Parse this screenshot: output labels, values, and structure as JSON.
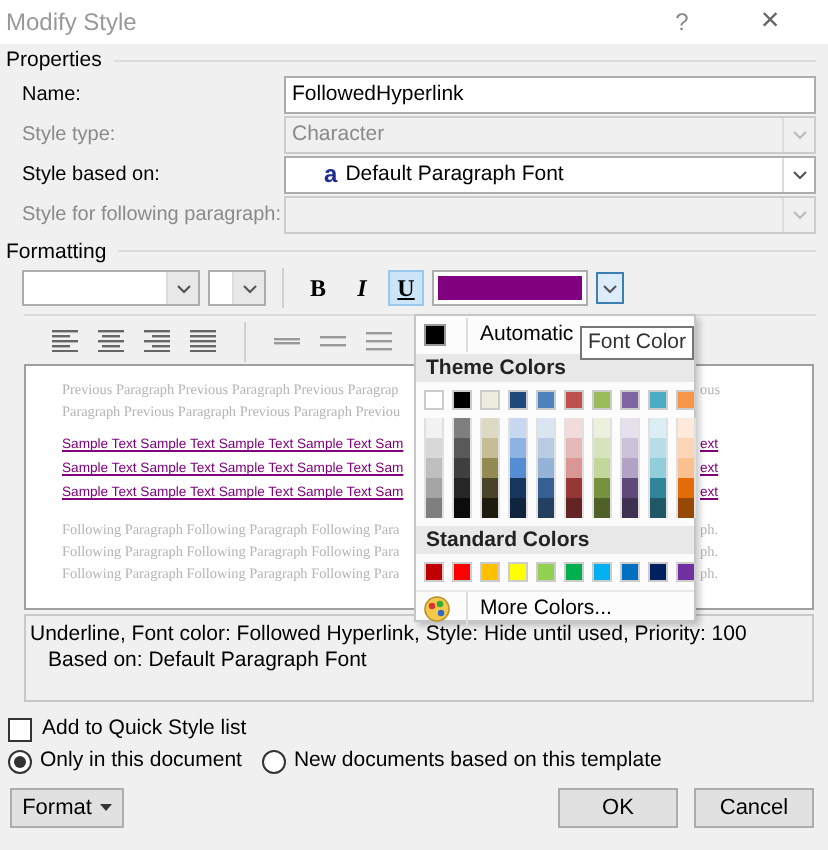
{
  "window": {
    "title": "Modify Style",
    "help": "?",
    "close": "×"
  },
  "properties": {
    "heading": "Properties",
    "fields": [
      {
        "label": "Name:",
        "kind": "text",
        "value": "FollowedHyperlink",
        "disabled": false
      },
      {
        "label": "Style type:",
        "kind": "select",
        "value": "Character",
        "disabled": true
      },
      {
        "label": "Style based on:",
        "kind": "select",
        "icon": "a",
        "value": "Default Paragraph Font",
        "disabled": false
      },
      {
        "label": "Style for following paragraph:",
        "kind": "select",
        "disabled": true
      }
    ]
  },
  "formatting": {
    "heading": "Formatting",
    "styles": [
      {
        "label": "B",
        "selected": false
      },
      {
        "label": "I",
        "selected": false
      },
      {
        "label": "U",
        "selected": true
      }
    ],
    "font_color": {
      "color": "#800080",
      "expanded": true
    }
  },
  "alignment": [
    {
      "kind": "left"
    },
    {
      "kind": "center"
    },
    {
      "kind": "right"
    },
    {
      "kind": "justify"
    },
    {
      "kind": "single"
    },
    {
      "kind": "onehalf"
    },
    {
      "kind": "double"
    }
  ],
  "preview": [
    {
      "kind": "previous",
      "left": "Previous Paragraph Previous Paragraph Previous Paragrap",
      "right": "ous"
    },
    {
      "kind": "previous",
      "left": "Paragraph Previous Paragraph Previous Paragraph Previou"
    },
    {
      "kind": "sample",
      "left": "Sample Text Sample Text Sample Text Sample Text Sam",
      "right": "ext"
    },
    {
      "kind": "sample",
      "left": "Sample Text Sample Text Sample Text Sample Text Sam",
      "right": "ext"
    },
    {
      "kind": "sample",
      "left": "Sample Text Sample Text Sample Text Sample Text Sam",
      "right": "ext"
    },
    {
      "kind": "following",
      "left": "Following Paragraph Following Paragraph Following Para",
      "right": "ph."
    },
    {
      "kind": "following",
      "left": "Following Paragraph Following Paragraph Following Para",
      "right": "ph."
    },
    {
      "kind": "following",
      "left": "Following Paragraph Following Paragraph Following Para",
      "right": "ph."
    }
  ],
  "color_menu": {
    "automatic": {
      "label": "Automatic",
      "color": "#000000"
    },
    "theme_heading": "Theme Colors",
    "theme_colors": [
      {
        "color": "#ffffff"
      },
      {
        "color": "#000000"
      },
      {
        "color": "#eeece1"
      },
      {
        "color": "#1f497d"
      },
      {
        "color": "#4f81bd"
      },
      {
        "color": "#c0504d"
      },
      {
        "color": "#9bbb59"
      },
      {
        "color": "#8064a2"
      },
      {
        "color": "#4bacc6"
      },
      {
        "color": "#f79646"
      }
    ],
    "theme_shades": [
      {
        "swatches": [
          {
            "color": "#f2f2f2"
          },
          {
            "color": "#7f7f7f"
          },
          {
            "color": "#ddd9c3"
          },
          {
            "color": "#c6d9f0"
          },
          {
            "color": "#dbe5f1"
          },
          {
            "color": "#f2dcdb"
          },
          {
            "color": "#ebf1dd"
          },
          {
            "color": "#e5e0ec"
          },
          {
            "color": "#dbeef3"
          },
          {
            "color": "#fdeada"
          }
        ]
      },
      {
        "swatches": [
          {
            "color": "#d8d8d8"
          },
          {
            "color": "#595959"
          },
          {
            "color": "#c4bd97"
          },
          {
            "color": "#8db3e2"
          },
          {
            "color": "#b8cce4"
          },
          {
            "color": "#e5b9b7"
          },
          {
            "color": "#d7e3bc"
          },
          {
            "color": "#ccc1d9"
          },
          {
            "color": "#b7dde8"
          },
          {
            "color": "#fbd5b5"
          }
        ]
      },
      {
        "swatches": [
          {
            "color": "#bfbfbf"
          },
          {
            "color": "#3f3f3f"
          },
          {
            "color": "#938953"
          },
          {
            "color": "#548dd4"
          },
          {
            "color": "#95b3d7"
          },
          {
            "color": "#d99694"
          },
          {
            "color": "#c3d69b"
          },
          {
            "color": "#b2a2c7"
          },
          {
            "color": "#92cddc"
          },
          {
            "color": "#fac08f"
          }
        ]
      },
      {
        "swatches": [
          {
            "color": "#a5a5a5"
          },
          {
            "color": "#262626"
          },
          {
            "color": "#494429"
          },
          {
            "color": "#17365d"
          },
          {
            "color": "#366092"
          },
          {
            "color": "#953734"
          },
          {
            "color": "#76923c"
          },
          {
            "color": "#5f497a"
          },
          {
            "color": "#31859b"
          },
          {
            "color": "#e36c09"
          }
        ]
      },
      {
        "swatches": [
          {
            "color": "#7f7f7f"
          },
          {
            "color": "#0c0c0c"
          },
          {
            "color": "#1d1b10"
          },
          {
            "color": "#0f243e"
          },
          {
            "color": "#244061"
          },
          {
            "color": "#632423"
          },
          {
            "color": "#4f6128"
          },
          {
            "color": "#3f3151"
          },
          {
            "color": "#205867"
          },
          {
            "color": "#974806"
          }
        ]
      }
    ],
    "standard_heading": "Standard Colors",
    "standard_colors": [
      {
        "color": "#c00000"
      },
      {
        "color": "#ff0000"
      },
      {
        "color": "#ffc000"
      },
      {
        "color": "#ffff00"
      },
      {
        "color": "#92d050"
      },
      {
        "color": "#00b050"
      },
      {
        "color": "#00b0f0"
      },
      {
        "color": "#0070c0"
      },
      {
        "color": "#002060"
      },
      {
        "color": "#7030a0"
      }
    ],
    "more": "More Colors..."
  },
  "tooltip": "Font Color",
  "description": [
    "Underline, Font color: Followed Hyperlink, Style: Hide until used, Priority: 100",
    "Based on: Default Paragraph Font"
  ],
  "quick_style": {
    "label": "Add to Quick Style list",
    "checked": false
  },
  "scope": [
    {
      "label": "Only in this document",
      "selected": true
    },
    {
      "label": "New documents based on this template",
      "selected": false
    }
  ],
  "buttons": [
    {
      "label": "Format",
      "kind": "menu"
    },
    {
      "label": "OK",
      "kind": "plain"
    },
    {
      "label": "Cancel",
      "kind": "plain"
    }
  ]
}
